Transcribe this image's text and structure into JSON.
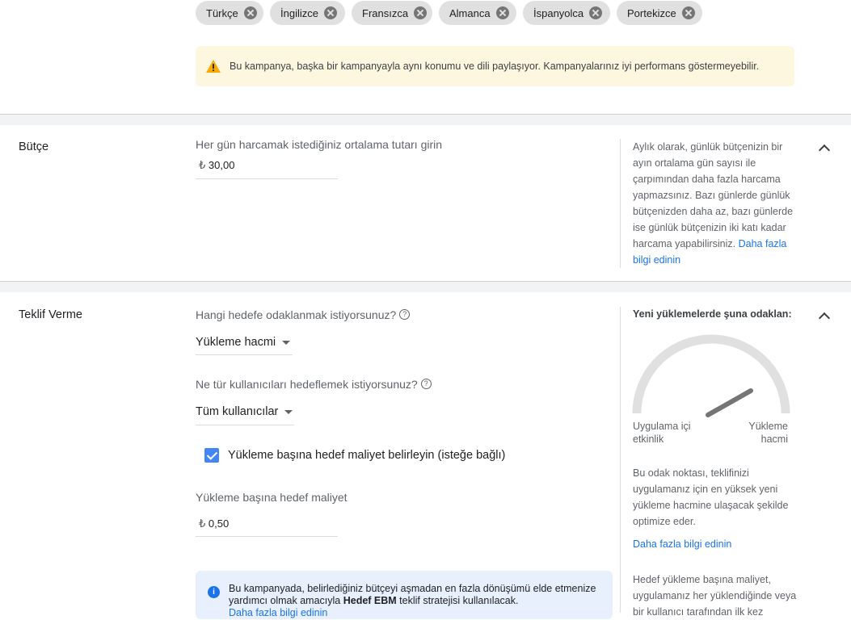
{
  "languages": {
    "chips": [
      "Türkçe",
      "İngilizce",
      "Fransızca",
      "Almanca",
      "İspanyolca",
      "Portekizce"
    ],
    "warning_text": "Bu kampanya, başka bir kampanyayla aynı konumu ve dili paylaşıyor. Kampanyalarınız iyi performans göstermeyebilir."
  },
  "budget": {
    "title": "Bütçe",
    "prompt": "Her gün harcamak istediğiniz ortalama tutarı girin",
    "currency": "₺",
    "value": "30,00",
    "help_text": "Aylık olarak, günlük bütçenizin bir ayın ortalama gün sayısı ile çarpımından daha fazla harcama yapmazsınız. Bazı günlerde günlük bütçenizden daha az, bazı günlerde ise günlük bütçenizin iki katı kadar harcama yapabilirsiniz.",
    "help_link": "Daha fazla bilgi edinin"
  },
  "bidding": {
    "title": "Teklif Verme",
    "focus_question": "Hangi hedefe odaklanmak istiyorsunuz?",
    "focus_value": "Yükleme hacmi",
    "users_question": "Ne tür kullanıcıları hedeflemek istiyorsunuz?",
    "users_value": "Tüm kullanıcılar",
    "checkbox_label": "Yükleme başına hedef maliyet belirleyin (isteğe bağlı)",
    "checkbox_checked": true,
    "target_cost_label": "Yükleme başına hedef maliyet",
    "currency": "₺",
    "target_cost_value": "0,50",
    "info_text_1": "Bu kampanyada, belirlediğiniz bütçeyi aşmadan en fazla dönüşümü elde etmenize yardımcı olmak amacıyla ",
    "info_bold": "Hedef EBM",
    "info_text_2": " teklif stratejisi kullanılacak.",
    "info_link": "Daha fazla bilgi edinin",
    "side_title": "Yeni yüklemelerde şuna odaklan:",
    "gauge_left_label": "Uygulama içi etkinlik",
    "gauge_right_label": "Yükleme hacmi",
    "side_text": "Bu odak noktası, teklifinizi uygulamanız için en yüksek yeni yükleme hacmine ulaşacak şekilde optimize eder.",
    "side_link": "Daha fazla bilgi edinin",
    "side_text_2": "Hedef yükleme başına maliyet, uygulamanız her yüklendiğinde veya bir kullanıcı tarafından ilk kez"
  },
  "colors": {
    "accent": "#1a73e8",
    "warning_bg": "#fef7e0",
    "warning_icon": "#f9ab00",
    "info_bg": "#e8f0fe"
  }
}
